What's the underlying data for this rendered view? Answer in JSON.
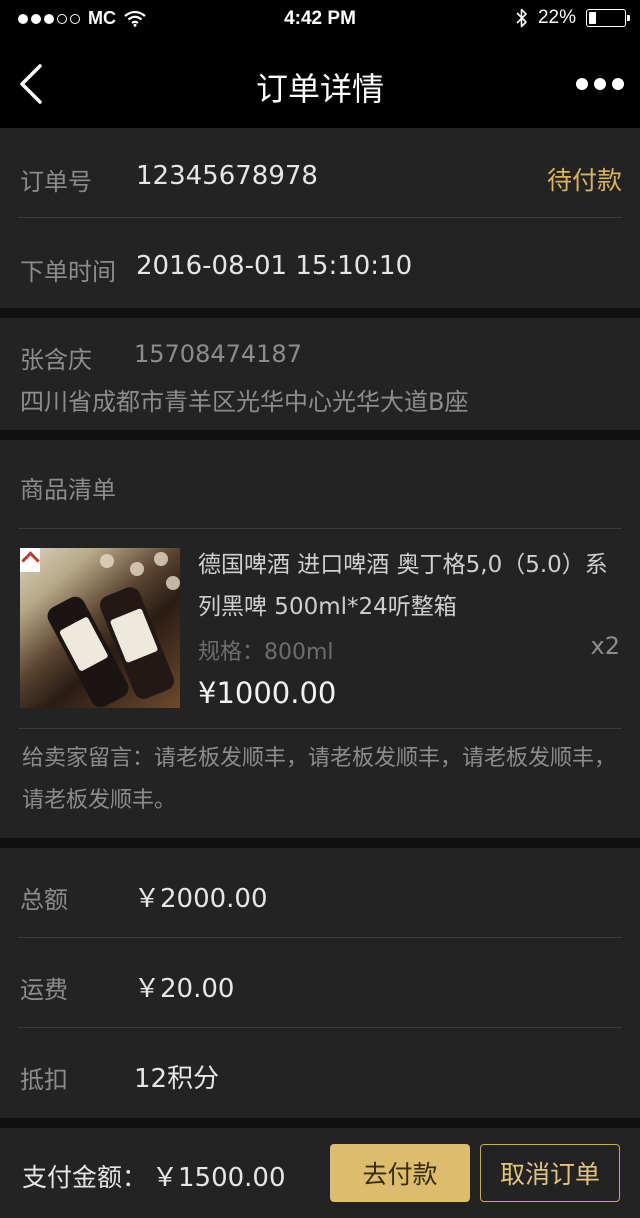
{
  "status_bar": {
    "carrier": "MC",
    "time": "4:42 PM",
    "battery": "22%",
    "battery_level": 0.22,
    "signal_bars_filled": 3,
    "signal_bars_total": 5
  },
  "nav": {
    "title": "订单详情",
    "back_icon": "chevron-left-icon",
    "more_icon": "more-horizontal-icon"
  },
  "order": {
    "number_label": "订单号",
    "number": "12345678978",
    "status": "待付款",
    "time_label": "下单时间",
    "time": "2016-08-01 15:10:10"
  },
  "address": {
    "name": "张含庆",
    "phone": "15708474187",
    "detail": "四川省成都市青羊区光华中心光华大道B座"
  },
  "goods": {
    "section_title": "商品清单",
    "items": [
      {
        "name": "德国啤酒 进口啤酒 奥丁格5,0（5.0）系列黑啤 500ml*24听整箱",
        "spec": "规格：800ml",
        "quantity": "x2",
        "price": "¥1000.00"
      }
    ],
    "seller_note": "给卖家留言：请老板发顺丰，请老板发顺丰，请老板发顺丰，请老板发顺丰。"
  },
  "summary": {
    "total_label": "总额",
    "total": "￥2000.00",
    "shipping_label": "运费",
    "shipping": "￥20.00",
    "deduction_label": "抵扣",
    "deduction": "12积分"
  },
  "footer": {
    "pay_amount_label": "支付金额：",
    "pay_amount": "￥1500.00",
    "pay_button": "去付款",
    "cancel_button": "取消订单"
  },
  "colors": {
    "accent": "#dcbd6e",
    "status": "#d9b25e",
    "background": "#232323"
  }
}
